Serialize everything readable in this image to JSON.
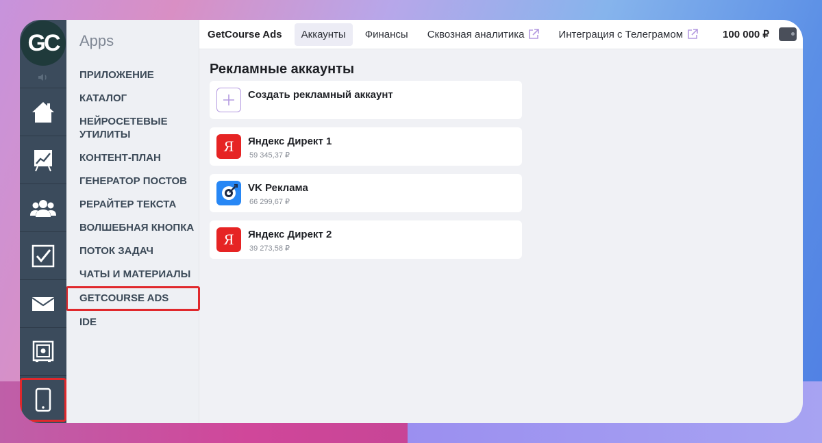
{
  "sidebar": {
    "logo": "GC",
    "apps_title": "Apps",
    "items": [
      {
        "label": "ПРИЛОЖЕНИЕ"
      },
      {
        "label": "КАТАЛОГ"
      },
      {
        "label": "НЕЙРОСЕТЕВЫЕ УТИЛИТЫ"
      },
      {
        "label": "КОНТЕНТ-ПЛАН"
      },
      {
        "label": "ГЕНЕРАТОР ПОСТОВ"
      },
      {
        "label": "РЕРАЙТЕР ТЕКСТА"
      },
      {
        "label": "ВОЛШЕБНАЯ КНОПКА"
      },
      {
        "label": "ПОТОК ЗАДАЧ"
      },
      {
        "label": "ЧАТЫ И МАТЕРИАЛЫ"
      },
      {
        "label": "GETCOURSE ADS",
        "active": true
      },
      {
        "label": "IDE"
      }
    ],
    "rail_icons": [
      "home-icon",
      "chart-icon",
      "users-icon",
      "tasks-icon",
      "mail-icon",
      "safe-icon",
      "phone-icon"
    ]
  },
  "header": {
    "brand": "GetCourse Ads",
    "tabs": [
      {
        "label": "Аккаунты",
        "active": true
      },
      {
        "label": "Финансы"
      },
      {
        "label": "Сквозная аналитика",
        "external": true
      },
      {
        "label": "Интеграция с Телеграмом",
        "external": true
      }
    ],
    "balance": "100 000 ₽"
  },
  "main": {
    "title": "Рекламные аккаунты",
    "create_label": "Создать рекламный аккаунт",
    "accounts": [
      {
        "name": "Яндекс Директ 1",
        "amount": "59 345,37 ₽",
        "icon": "yandex-icon"
      },
      {
        "name": "VK Реклама",
        "amount": "66 299,67 ₽",
        "icon": "vk-icon"
      },
      {
        "name": "Яндекс Директ 2",
        "amount": "39 273,58 ₽",
        "icon": "yandex-icon"
      }
    ]
  },
  "colors": {
    "rail": "#3b4b5c",
    "highlight": "#e0282c",
    "yandex": "#e62424",
    "vk": "#2787f5",
    "accent": "#b49ae0"
  }
}
